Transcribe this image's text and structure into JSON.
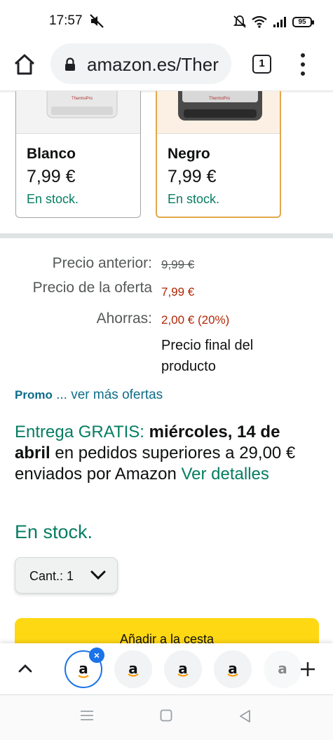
{
  "status_bar": {
    "time": "17:57",
    "battery": "95",
    "icons": [
      "mute-icon",
      "silent-bell-icon",
      "wifi-icon",
      "signal-icon",
      "battery-icon"
    ]
  },
  "browser": {
    "url": "amazon.es/Ther",
    "tab_count": "1",
    "icons": [
      "home-icon",
      "lock-icon",
      "tab-switcher-icon",
      "menu-icon"
    ]
  },
  "variants": [
    {
      "name": "Blanco",
      "price": "7,99 €",
      "stock": "En stock.",
      "brand_mark": "ThermoPro"
    },
    {
      "name": "Negro",
      "price": "7,99 €",
      "stock": "En stock.",
      "brand_mark": "ThermoPro"
    }
  ],
  "pricing": {
    "previous_label": "Precio anterior:",
    "previous_value": "9,99 €",
    "offer_label": "Precio de la oferta",
    "offer_value": "7,99 €",
    "savings_label": "Ahorras:",
    "savings_value": "2,00 € (20%)",
    "final_note": "Precio final del producto"
  },
  "promo": {
    "label": "Promo",
    "link": "... ver más ofertas"
  },
  "delivery": {
    "free": "Entrega GRATIS:",
    "date": "miércoles, 14 de abril",
    "text": "en pedidos superiores a 29,00 € enviados por Amazon",
    "link": "Ver detalles"
  },
  "availability": "En stock.",
  "quantity": {
    "label": "Cant.:",
    "value": "1"
  },
  "add_to_cart": "Añadir a la cesta",
  "tab_strip": {
    "tab_logo": "a",
    "tabs": 5,
    "close": "×"
  },
  "colors": {
    "accent_teal": "#067d62",
    "price_red": "#b12704",
    "link_blue": "#0e6c8a",
    "button_yellow": "#ffd814",
    "selected_border": "#e3a84c",
    "tab_blue": "#1a73e8"
  }
}
